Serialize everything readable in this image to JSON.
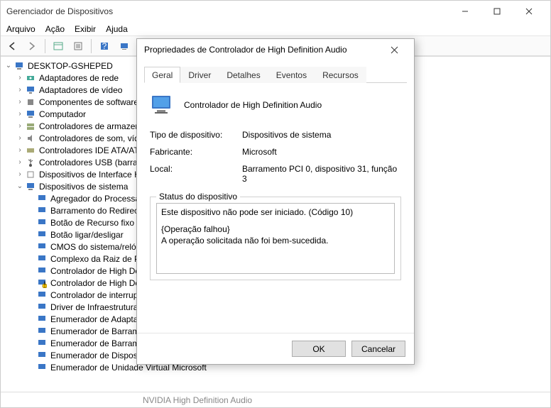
{
  "window": {
    "title": "Gerenciador de Dispositivos"
  },
  "menu": {
    "arquivo": "Arquivo",
    "acao": "Ação",
    "exibir": "Exibir",
    "ajuda": "Ajuda"
  },
  "tree": {
    "root": "DESKTOP-GSHEPED",
    "items": [
      "Adaptadores de rede",
      "Adaptadores de vídeo",
      "Componentes de software",
      "Computador",
      "Controladores de armazenamento",
      "Controladores de som, vídeo e jogos",
      "Controladores IDE ATA/ATAPI",
      "Controladores USB (barramento serial universal)",
      "Dispositivos de Interface Humana",
      "Dispositivos de sistema"
    ],
    "sys_children": [
      "Agregador do Processador",
      "Barramento do Redirecionador",
      "Botão de Recurso fixo",
      "Botão ligar/desligar",
      "CMOS do sistema/relógio",
      "Complexo da Raiz de PCI Express",
      "Controlador de High Definition Audio",
      "Controlador de High Definition Audio",
      "Controlador de interrupção",
      "Driver de Infraestrutura",
      "Enumerador de Adaptador",
      "Enumerador de Barramento",
      "Enumerador de Barramento",
      "Enumerador de Dispositivos de Software Plug and Play",
      "Enumerador de Unidade Virtual Microsoft"
    ]
  },
  "bottom_cut": "NVIDIA High Definition Audio",
  "dialog": {
    "title": "Propriedades de Controlador de High Definition Audio",
    "tabs": {
      "geral": "Geral",
      "driver": "Driver",
      "detalhes": "Detalhes",
      "eventos": "Eventos",
      "recursos": "Recursos"
    },
    "device_name": "Controlador de High Definition Audio",
    "props": {
      "type_k": "Tipo de dispositivo:",
      "type_v": "Dispositivos de sistema",
      "maker_k": "Fabricante:",
      "maker_v": "Microsoft",
      "local_k": "Local:",
      "local_v": "Barramento PCI 0, dispositivo 31, função 3"
    },
    "status_legend": "Status do dispositivo",
    "status_line1": "Este dispositivo não pode ser iniciado. (Código 10)",
    "status_line2": "{Operação falhou}",
    "status_line3": "A operação solicitada não foi bem-sucedida.",
    "ok": "OK",
    "cancel": "Cancelar"
  }
}
